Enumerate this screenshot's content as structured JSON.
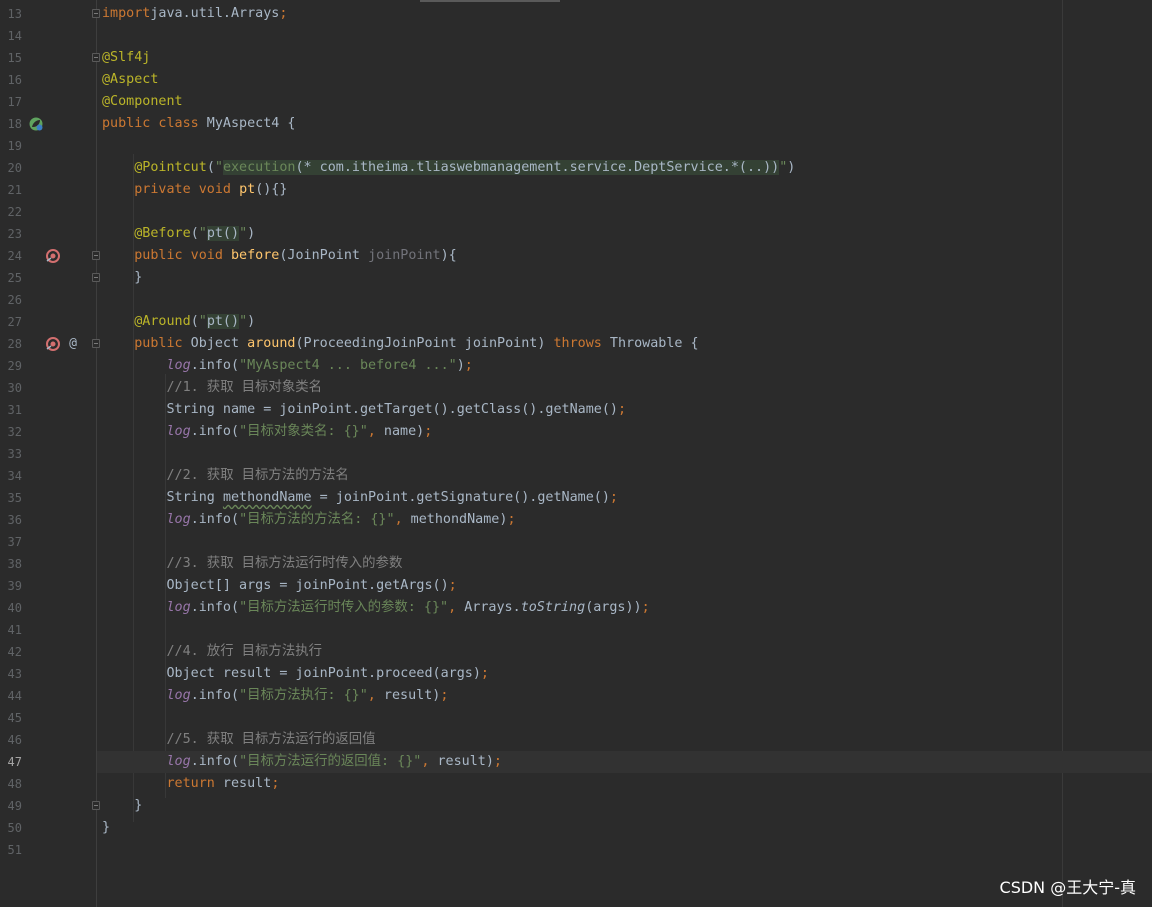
{
  "lines": [
    {
      "n": "13",
      "fold": true,
      "segs": [
        [
          "kw",
          "import"
        ],
        [
          "",
          "java.util.Arrays"
        ],
        [
          "kw",
          ";"
        ]
      ]
    },
    {
      "n": "14",
      "segs": []
    },
    {
      "n": "15",
      "fold": true,
      "segs": [
        [
          "ann",
          "@Slf4j"
        ]
      ]
    },
    {
      "n": "16",
      "segs": [
        [
          "ann",
          "@Aspect"
        ]
      ]
    },
    {
      "n": "17",
      "segs": [
        [
          "ann",
          "@Component"
        ]
      ]
    },
    {
      "n": "18",
      "icon": "spring-bean",
      "segs": [
        [
          "kw",
          "public class"
        ],
        [
          "",
          " MyAspect4 {"
        ]
      ]
    },
    {
      "n": "19",
      "segs": []
    },
    {
      "n": "20",
      "segs": [
        [
          "",
          "    "
        ],
        [
          "ann",
          "@Pointcut"
        ],
        [
          "",
          "("
        ],
        [
          "str",
          "\""
        ],
        [
          "str hl",
          "execution"
        ],
        [
          "hl",
          "(* com.itheima.tliaswebmanagement.service.DeptService.*(..))"
        ],
        [
          "str",
          "\""
        ],
        [
          "",
          ")"
        ]
      ]
    },
    {
      "n": "21",
      "segs": [
        [
          "",
          "    "
        ],
        [
          "kw",
          "private void"
        ],
        [
          "",
          " "
        ],
        [
          "fn",
          "pt"
        ],
        [
          "",
          "(){}"
        ]
      ]
    },
    {
      "n": "22",
      "segs": []
    },
    {
      "n": "23",
      "segs": [
        [
          "",
          "    "
        ],
        [
          "ann",
          "@Before"
        ],
        [
          "",
          "("
        ],
        [
          "str",
          "\""
        ],
        [
          "hl",
          "pt()"
        ],
        [
          "str",
          "\""
        ],
        [
          "",
          ")"
        ]
      ]
    },
    {
      "n": "24",
      "icon": "aop",
      "fold": true,
      "segs": [
        [
          "",
          "    "
        ],
        [
          "kw",
          "public void"
        ],
        [
          "",
          " "
        ],
        [
          "fn",
          "before"
        ],
        [
          "",
          "(JoinPoint "
        ],
        [
          "param",
          "joinPoint"
        ],
        [
          "",
          "){"
        ]
      ]
    },
    {
      "n": "25",
      "fold": true,
      "segs": [
        [
          "",
          "    }"
        ]
      ]
    },
    {
      "n": "26",
      "segs": []
    },
    {
      "n": "27",
      "segs": [
        [
          "",
          "    "
        ],
        [
          "ann",
          "@Around"
        ],
        [
          "",
          "("
        ],
        [
          "str",
          "\""
        ],
        [
          "hl",
          "pt()"
        ],
        [
          "str",
          "\""
        ],
        [
          "",
          ")"
        ]
      ]
    },
    {
      "n": "28",
      "icon": "aop",
      "at": true,
      "fold": true,
      "segs": [
        [
          "",
          "    "
        ],
        [
          "kw",
          "public"
        ],
        [
          "",
          " Object "
        ],
        [
          "fn",
          "around"
        ],
        [
          "",
          "(ProceedingJoinPoint joinPoint) "
        ],
        [
          "kw",
          "throws"
        ],
        [
          "",
          " Throwable {"
        ]
      ]
    },
    {
      "n": "29",
      "segs": [
        [
          "",
          "        "
        ],
        [
          "fld",
          "log"
        ],
        [
          "",
          ".info("
        ],
        [
          "str",
          "\"MyAspect4 ... before4 ...\""
        ],
        [
          "",
          ")"
        ],
        [
          "kw",
          ";"
        ]
      ]
    },
    {
      "n": "30",
      "segs": [
        [
          "",
          "        "
        ],
        [
          "cmt",
          "//1. 获取 目标对象类名"
        ]
      ]
    },
    {
      "n": "31",
      "segs": [
        [
          "",
          "        String name = joinPoint.getTarget().getClass().getName()"
        ],
        [
          "kw",
          ";"
        ]
      ]
    },
    {
      "n": "32",
      "segs": [
        [
          "",
          "        "
        ],
        [
          "fld",
          "log"
        ],
        [
          "",
          ".info("
        ],
        [
          "str",
          "\"目标对象类名: {}\""
        ],
        [
          "kw",
          ","
        ],
        [
          "",
          " name)"
        ],
        [
          "kw",
          ";"
        ]
      ]
    },
    {
      "n": "33",
      "segs": []
    },
    {
      "n": "34",
      "segs": [
        [
          "",
          "        "
        ],
        [
          "cmt",
          "//2. 获取 目标方法的方法名"
        ]
      ]
    },
    {
      "n": "35",
      "segs": [
        [
          "",
          "        String "
        ],
        [
          "warn",
          "methondName"
        ],
        [
          "",
          " = joinPoint.getSignature().getName()"
        ],
        [
          "kw",
          ";"
        ]
      ]
    },
    {
      "n": "36",
      "segs": [
        [
          "",
          "        "
        ],
        [
          "fld",
          "log"
        ],
        [
          "",
          ".info("
        ],
        [
          "str",
          "\"目标方法的方法名: {}\""
        ],
        [
          "kw",
          ","
        ],
        [
          "",
          " methondName)"
        ],
        [
          "kw",
          ";"
        ]
      ]
    },
    {
      "n": "37",
      "segs": []
    },
    {
      "n": "38",
      "segs": [
        [
          "",
          "        "
        ],
        [
          "cmt",
          "//3. 获取 目标方法运行时传入的参数"
        ]
      ]
    },
    {
      "n": "39",
      "segs": [
        [
          "",
          "        Object[] args = joinPoint.getArgs()"
        ],
        [
          "kw",
          ";"
        ]
      ]
    },
    {
      "n": "40",
      "segs": [
        [
          "",
          "        "
        ],
        [
          "fld",
          "log"
        ],
        [
          "",
          ".info("
        ],
        [
          "str",
          "\"目标方法运行时传入的参数: {}\""
        ],
        [
          "kw",
          ","
        ],
        [
          "",
          " Arrays."
        ],
        [
          "ital",
          "toString"
        ],
        [
          "",
          "(args))"
        ],
        [
          "kw",
          ";"
        ]
      ]
    },
    {
      "n": "41",
      "segs": []
    },
    {
      "n": "42",
      "segs": [
        [
          "",
          "        "
        ],
        [
          "cmt",
          "//4. 放行 目标方法执行"
        ]
      ]
    },
    {
      "n": "43",
      "segs": [
        [
          "",
          "        Object result = joinPoint.proceed(args)"
        ],
        [
          "kw",
          ";"
        ]
      ]
    },
    {
      "n": "44",
      "segs": [
        [
          "",
          "        "
        ],
        [
          "fld",
          "log"
        ],
        [
          "",
          ".info("
        ],
        [
          "str",
          "\"目标方法执行: {}\""
        ],
        [
          "kw",
          ","
        ],
        [
          "",
          " result)"
        ],
        [
          "kw",
          ";"
        ]
      ]
    },
    {
      "n": "45",
      "segs": []
    },
    {
      "n": "46",
      "segs": [
        [
          "",
          "        "
        ],
        [
          "cmt",
          "//5. 获取 目标方法运行的返回值"
        ]
      ]
    },
    {
      "n": "47",
      "current": true,
      "segs": [
        [
          "",
          "        "
        ],
        [
          "fld",
          "log"
        ],
        [
          "",
          ".info("
        ],
        [
          "str",
          "\"目标方法运行的返回值: {}\""
        ],
        [
          "kw",
          ","
        ],
        [
          "",
          " result)"
        ],
        [
          "kw",
          ";"
        ]
      ]
    },
    {
      "n": "48",
      "segs": [
        [
          "",
          "        "
        ],
        [
          "kw",
          "return"
        ],
        [
          "",
          " result"
        ],
        [
          "kw",
          ";"
        ]
      ]
    },
    {
      "n": "49",
      "fold": true,
      "segs": [
        [
          "",
          "    }"
        ]
      ]
    },
    {
      "n": "50",
      "segs": [
        [
          "",
          "}"
        ]
      ]
    },
    {
      "n": "51",
      "segs": []
    }
  ],
  "gutter_at_symbol": "@",
  "watermark": "CSDN @王大宁-真"
}
